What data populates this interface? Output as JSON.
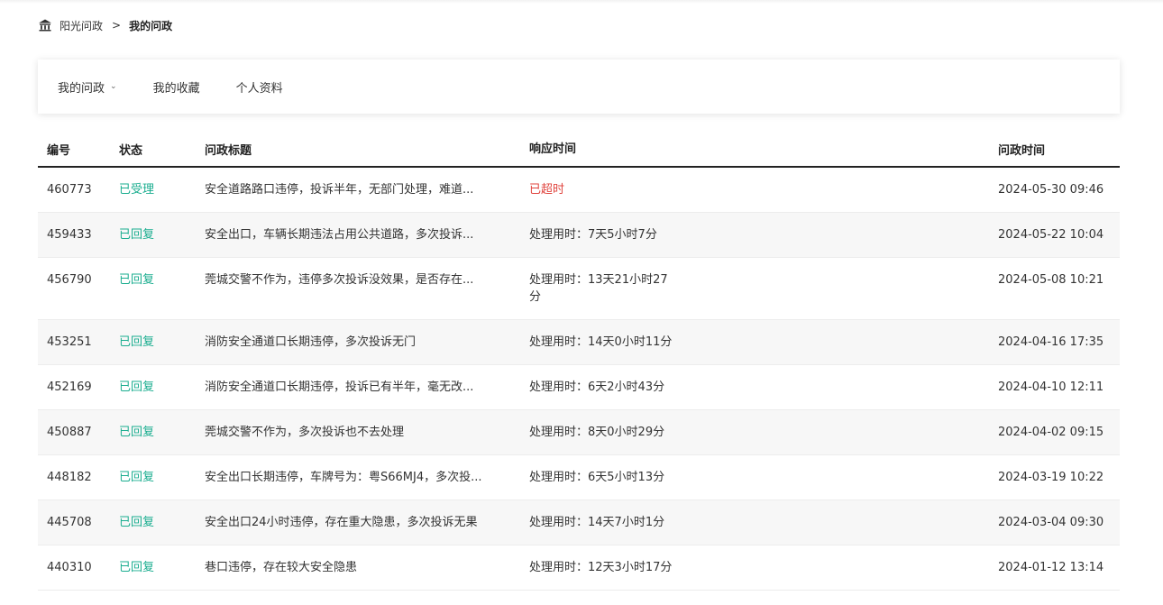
{
  "breadcrumb": {
    "home_label": "阳光问政",
    "separator": ">",
    "current": "我的问政"
  },
  "tabs": [
    {
      "label": "我的问政",
      "has_dropdown": true
    },
    {
      "label": "我的收藏",
      "has_dropdown": false
    },
    {
      "label": "个人资料",
      "has_dropdown": false
    }
  ],
  "table": {
    "headers": {
      "id": "编号",
      "status": "状态",
      "title": "问政标题",
      "response": "响应时间",
      "time": "问政时间"
    },
    "rows": [
      {
        "id": "460773",
        "status": "已受理",
        "title": "安全道路路口违停，投诉半年，无部门处理，难道...",
        "response": "已超时",
        "time": "2024-05-30 09:46"
      },
      {
        "id": "459433",
        "status": "已回复",
        "title": "安全出口，车辆长期违法占用公共道路，多次投诉...",
        "response": "处理用时：7天5小时7分",
        "time": "2024-05-22 10:04"
      },
      {
        "id": "456790",
        "status": "已回复",
        "title": "莞城交警不作为，违停多次投诉没效果，是否存在...",
        "response": "处理用时：13天21小时27分",
        "time": "2024-05-08 10:21"
      },
      {
        "id": "453251",
        "status": "已回复",
        "title": "消防安全通道口长期违停，多次投诉无门",
        "response": "处理用时：14天0小时11分",
        "time": "2024-04-16 17:35"
      },
      {
        "id": "452169",
        "status": "已回复",
        "title": "消防安全通道口长期违停，投诉已有半年，毫无改...",
        "response": "处理用时：6天2小时43分",
        "time": "2024-04-10 12:11"
      },
      {
        "id": "450887",
        "status": "已回复",
        "title": "莞城交警不作为，多次投诉也不去处理",
        "response": "处理用时：8天0小时29分",
        "time": "2024-04-02 09:15"
      },
      {
        "id": "448182",
        "status": "已回复",
        "title": "安全出口长期违停，车牌号为：粤S66MJ4，多次投...",
        "response": "处理用时：6天5小时13分",
        "time": "2024-03-19 10:22"
      },
      {
        "id": "445708",
        "status": "已回复",
        "title": "安全出口24小时违停，存在重大隐患，多次投诉无果",
        "response": "处理用时：14天7小时1分",
        "time": "2024-03-04 09:30"
      },
      {
        "id": "440310",
        "status": "已回复",
        "title": "巷口违停，存在较大安全隐患",
        "response": "处理用时：12天3小时17分",
        "time": "2024-01-12 13:14"
      }
    ]
  },
  "colors": {
    "accent_green": "#1aad8f",
    "overdue_red": "#e0443e"
  }
}
